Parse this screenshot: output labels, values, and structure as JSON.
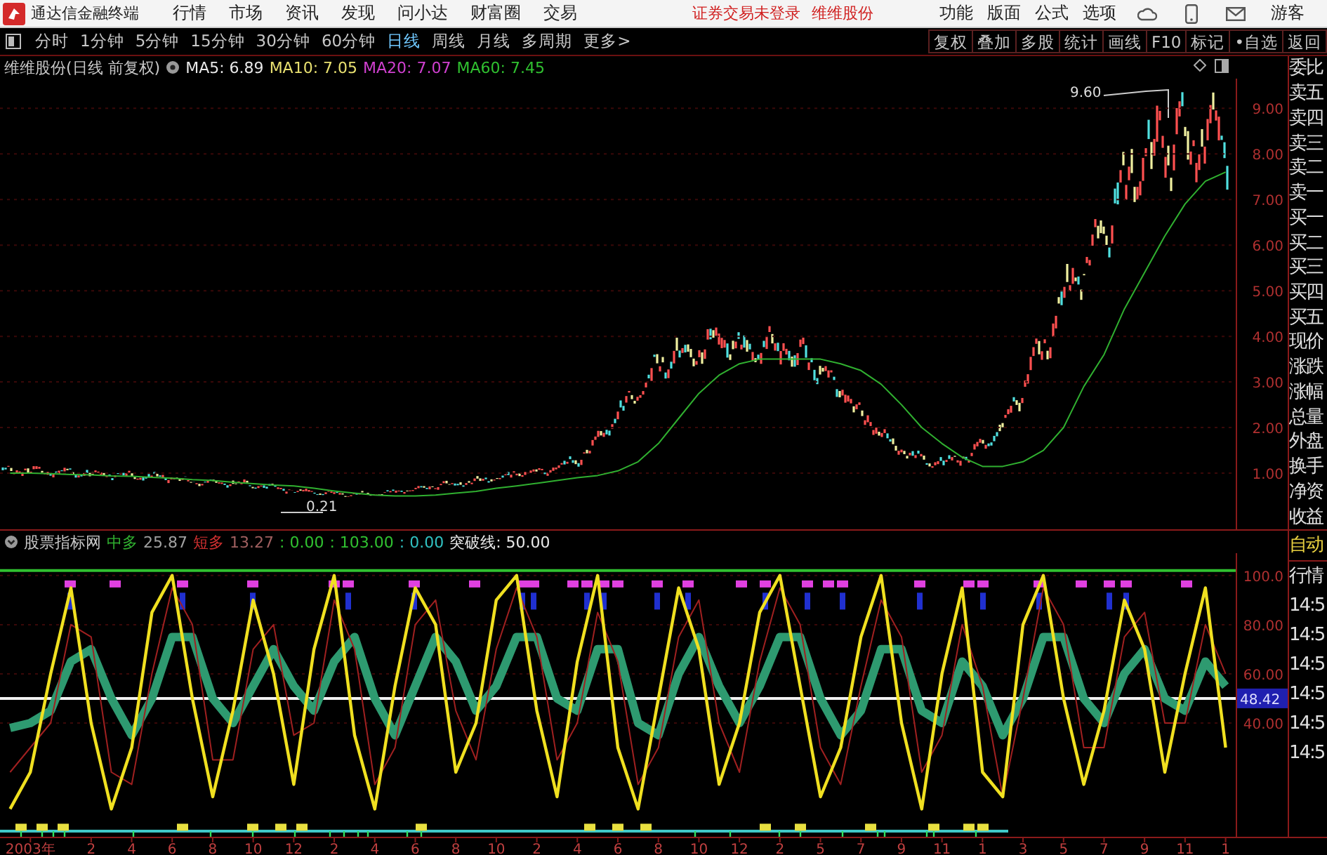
{
  "menubar": {
    "app_title": "通达信金融终端",
    "menus": [
      {
        "label": "行情"
      },
      {
        "label": "市场"
      },
      {
        "label": "资讯"
      },
      {
        "label": "发现"
      },
      {
        "label": "问小达"
      },
      {
        "label": "财富圈"
      },
      {
        "label": "交易"
      }
    ],
    "notices": [
      {
        "text": "证券交易未登录"
      },
      {
        "text": "维维股份"
      }
    ],
    "right_menus": [
      {
        "label": "功能"
      },
      {
        "label": "版面"
      },
      {
        "label": "公式"
      },
      {
        "label": "选项"
      }
    ],
    "user": "游客"
  },
  "toolbar": {
    "periods": [
      {
        "label": "分时",
        "selected": false
      },
      {
        "label": "1分钟",
        "selected": false
      },
      {
        "label": "5分钟",
        "selected": false
      },
      {
        "label": "15分钟",
        "selected": false
      },
      {
        "label": "30分钟",
        "selected": false
      },
      {
        "label": "60分钟",
        "selected": false
      },
      {
        "label": "日线",
        "selected": true
      },
      {
        "label": "周线",
        "selected": false
      },
      {
        "label": "月线",
        "selected": false
      },
      {
        "label": "多周期",
        "selected": false
      },
      {
        "label": "更多>",
        "selected": false
      }
    ],
    "buttons": [
      {
        "label": "复权"
      },
      {
        "label": "叠加"
      },
      {
        "label": "多股"
      },
      {
        "label": "统计"
      },
      {
        "label": "画线"
      },
      {
        "label": "F10"
      },
      {
        "label": "标记"
      },
      {
        "label": "•自选"
      },
      {
        "label": "返回"
      }
    ]
  },
  "price_chart": {
    "title": "维维股份(日线 前复权)",
    "averages": [
      {
        "text": "MA5: 6.89",
        "color": "#e8e8e8"
      },
      {
        "text": "MA10: 7.05",
        "color": "#e8e070"
      },
      {
        "text": "MA20: 7.07",
        "color": "#d040d0"
      },
      {
        "text": "MA60: 7.45",
        "color": "#30c030"
      }
    ],
    "high_label": "9.60",
    "low_label": "0.21",
    "chart_data": {
      "type": "line",
      "categories": [
        null,
        null,
        null,
        null,
        null,
        null,
        null,
        null,
        null,
        null,
        null,
        null,
        null,
        null,
        null,
        null,
        null,
        null,
        null,
        null,
        null,
        null,
        null,
        null,
        null,
        null,
        null,
        null,
        null,
        null,
        null,
        null,
        null,
        null,
        null,
        null,
        null,
        null,
        null,
        null,
        null,
        null,
        null,
        null,
        null,
        null,
        null,
        null,
        null,
        null,
        null,
        null,
        null,
        null,
        null,
        null,
        null,
        null,
        null,
        null,
        null
      ],
      "ylim": [
        -0.23,
        9.65
      ],
      "grid": true,
      "yticks": [
        {
          "value": 9,
          "label": "9.00"
        },
        {
          "value": 8,
          "label": "8.00"
        },
        {
          "value": 7,
          "label": "7.00"
        },
        {
          "value": 6,
          "label": "6.00"
        },
        {
          "value": 5,
          "label": "5.00"
        },
        {
          "value": 4,
          "label": "4.00"
        },
        {
          "value": 3,
          "label": "3.00"
        },
        {
          "value": 2,
          "label": "2.00"
        },
        {
          "value": 1,
          "label": "1.00"
        }
      ],
      "series": [
        {
          "color": "#30b030",
          "values": [
            1.0,
            1.0,
            0.99,
            0.97,
            0.96,
            0.94,
            0.93,
            0.91,
            0.89,
            0.86,
            0.84,
            0.8,
            0.77,
            0.74,
            0.72,
            0.67,
            0.61,
            0.56,
            0.52,
            0.5,
            0.5,
            0.52,
            0.56,
            0.6,
            0.67,
            0.72,
            0.78,
            0.84,
            0.9,
            0.95,
            1.05,
            1.25,
            1.65,
            2.2,
            2.75,
            3.15,
            3.4,
            3.5,
            3.5,
            3.5,
            3.5,
            3.4,
            3.25,
            2.95,
            2.5,
            2.0,
            1.65,
            1.35,
            1.15,
            1.15,
            1.25,
            1.5,
            2.0,
            2.9,
            3.6,
            4.6,
            5.4,
            6.2,
            6.9,
            7.4,
            7.6
          ]
        }
      ]
    },
    "sidebar": [
      "委比",
      "卖五",
      "卖四",
      "卖三",
      "卖二",
      "卖一",
      "买一",
      "买二",
      "买三",
      "买四",
      "买五",
      "现价",
      "涨跌",
      "涨幅",
      "总量",
      "外盘",
      "换手",
      "净资",
      "收益"
    ]
  },
  "indicator": {
    "name": "股票指标网",
    "values": [
      {
        "text": "中多",
        "color": "#30b030"
      },
      {
        "text": "25.87",
        "color": "#a0a0a0"
      },
      {
        "text": "短多",
        "color": "#d03030"
      },
      {
        "text": "13.27",
        "color": "#a06060"
      },
      {
        "text": ": 0.00",
        "color": "#30c030"
      },
      {
        "text": ": 103.00",
        "color": "#30c030"
      },
      {
        "text": ": 0.00",
        "color": "#30c0c0"
      },
      {
        "text": "突破线: 50.00",
        "color": "#e8e8e8"
      }
    ],
    "chart_data": {
      "type": "line",
      "categories": [
        null,
        "2003年",
        null,
        null,
        "2",
        null,
        "4",
        null,
        "6",
        null,
        "8",
        null,
        "10",
        null,
        "12",
        null,
        "2",
        null,
        "4",
        null,
        "6",
        null,
        "8",
        null,
        "10",
        null,
        "2",
        null,
        "4",
        null,
        "6",
        null,
        "8",
        null,
        "10",
        null,
        "12",
        null,
        "2",
        null,
        "5",
        null,
        "7",
        null,
        "9",
        null,
        "11",
        null,
        "1",
        null,
        "3",
        null,
        "5",
        null,
        "7",
        null,
        "9",
        null,
        "11",
        null,
        "1"
      ],
      "yticks": [
        {
          "value": 100,
          "label": "100.0"
        },
        {
          "value": 80,
          "label": "80.00"
        },
        {
          "value": 60,
          "label": "60.00"
        },
        {
          "value": 40,
          "label": "40.00"
        }
      ],
      "ylim": [
        -6.3,
        109.1
      ],
      "grid": true,
      "series": [
        {
          "color": "#2e9a70",
          "values": [
            38,
            40,
            45,
            65,
            70,
            50,
            35,
            50,
            75,
            75,
            50,
            40,
            55,
            70,
            55,
            45,
            65,
            75,
            50,
            35,
            55,
            75,
            65,
            45,
            55,
            75,
            75,
            50,
            45,
            70,
            70,
            40,
            35,
            60,
            75,
            55,
            40,
            55,
            75,
            75,
            50,
            35,
            45,
            70,
            70,
            45,
            40,
            65,
            55,
            35,
            50,
            75,
            75,
            50,
            40,
            60,
            70,
            50,
            45,
            65,
            55
          ]
        },
        {
          "color": "#a02020",
          "values": [
            20,
            30,
            40,
            80,
            75,
            20,
            15,
            60,
            95,
            80,
            25,
            25,
            70,
            80,
            35,
            40,
            90,
            70,
            15,
            30,
            80,
            90,
            45,
            25,
            70,
            95,
            75,
            25,
            40,
            85,
            65,
            15,
            30,
            75,
            90,
            40,
            20,
            65,
            95,
            80,
            30,
            15,
            55,
            90,
            75,
            20,
            35,
            80,
            55,
            10,
            50,
            95,
            80,
            30,
            30,
            75,
            85,
            40,
            40,
            80,
            60
          ]
        },
        {
          "color": "#f0e020",
          "values": [
            5,
            20,
            60,
            95,
            40,
            5,
            30,
            85,
            100,
            50,
            10,
            45,
            90,
            60,
            15,
            70,
            100,
            35,
            5,
            55,
            95,
            80,
            20,
            40,
            90,
            100,
            45,
            10,
            65,
            100,
            30,
            5,
            50,
            95,
            70,
            15,
            40,
            85,
            100,
            55,
            10,
            30,
            75,
            100,
            40,
            5,
            60,
            95,
            20,
            10,
            80,
            100,
            50,
            15,
            45,
            90,
            70,
            20,
            60,
            95,
            30
          ]
        }
      ]
    },
    "current": "48.42",
    "sidebar": [
      {
        "text": "自动",
        "kind": "mode"
      },
      {
        "text": "行情",
        "kind": "label"
      },
      {
        "text": "14:5",
        "kind": "time"
      },
      {
        "text": "14:5",
        "kind": "time"
      },
      {
        "text": "14:5",
        "kind": "time"
      },
      {
        "text": "14:5",
        "kind": "time"
      },
      {
        "text": "14:5",
        "kind": "time"
      },
      {
        "text": "14:5",
        "kind": "time"
      }
    ]
  }
}
